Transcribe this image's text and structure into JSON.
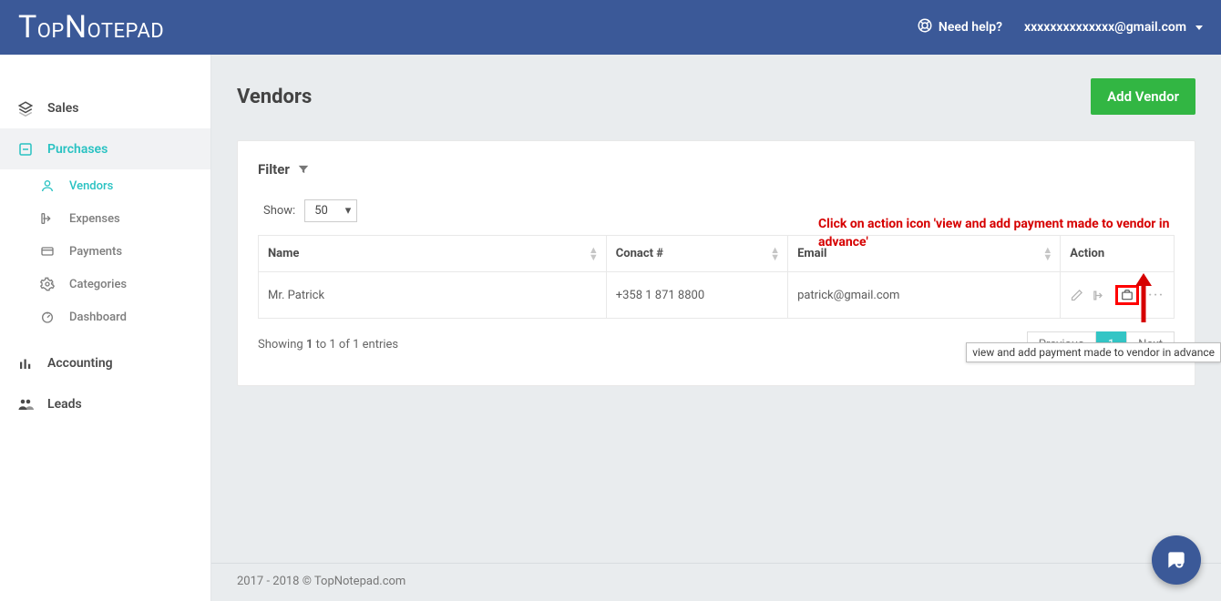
{
  "header": {
    "logo_text": "TopNotepad",
    "help_label": "Need help?",
    "user_email": "xxxxxxxxxxxxxx@gmail.com"
  },
  "sidebar": {
    "sales_label": "Sales",
    "purchases_label": "Purchases",
    "sub": {
      "vendors": "Vendors",
      "expenses": "Expenses",
      "payments": "Payments",
      "categories": "Categories",
      "dashboard": "Dashboard"
    },
    "accounting_label": "Accounting",
    "leads_label": "Leads"
  },
  "page": {
    "title": "Vendors",
    "add_button": "Add Vendor",
    "filter_label": "Filter",
    "show_label": "Show:",
    "show_value": "50",
    "columns": {
      "name": "Name",
      "contact": "Conact #",
      "email": "Email",
      "action": "Action"
    },
    "rows": [
      {
        "name": "Mr. Patrick",
        "contact": "+358 1 871 8800",
        "email": "patrick@gmail.com"
      }
    ],
    "showing_text_pre": "Showing ",
    "showing_from": "1",
    "showing_mid": " to 1 of 1 entries",
    "pagination": {
      "prev": "Previous",
      "current": "1",
      "next": "Next"
    }
  },
  "annotation": {
    "text": "Click on action icon 'view and add payment made to vendor in advance'",
    "tooltip": "view and add payment made to vendor in advance"
  },
  "footer": {
    "text": "2017 - 2018 © TopNotepad.com"
  }
}
